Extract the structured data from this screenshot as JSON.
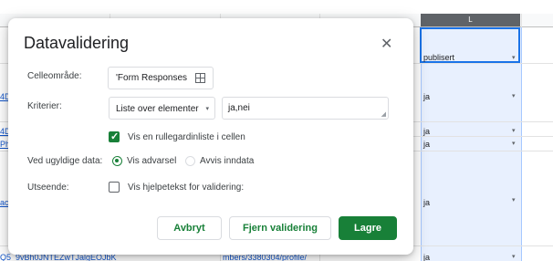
{
  "sheet": {
    "column_l_header": "L",
    "column_l_cells": [
      "publisert",
      "ja",
      "ja",
      "ja",
      "ja",
      "ja"
    ],
    "left_fragments": [
      "4D",
      "4D",
      "Ph",
      "ac"
    ],
    "bottom_left_fragment": "Q5_9vBh0JNTEZwTJalgEOJbK",
    "bottom_mid_fragment": "mbers/3380304/profile/",
    "dropdown_glyph": "▾"
  },
  "dialog": {
    "title": "Datavalidering",
    "close_glyph": "✕",
    "cell_range_label": "Celleområde:",
    "cell_range_value": "'Form Responses",
    "criteria_label": "Kriterier:",
    "criteria_type": "Liste over elementer",
    "criteria_caret": "▾",
    "criteria_list_value": "ja,nei",
    "dropdown_in_cell_label": "Vis en rullegardinliste i cellen",
    "dropdown_in_cell_checked": true,
    "invalid_data_label": "Ved ugyldige data:",
    "invalid_option_warn": "Vis advarsel",
    "invalid_option_reject": "Avvis inndata",
    "invalid_selected": "warn",
    "appearance_label": "Utseende:",
    "help_text_label": "Vis hjelpetekst for validering:",
    "help_text_checked": false,
    "cancel_label": "Avbryt",
    "remove_label": "Fjern validering",
    "save_label": "Lagre",
    "accent_color": "#188038"
  }
}
